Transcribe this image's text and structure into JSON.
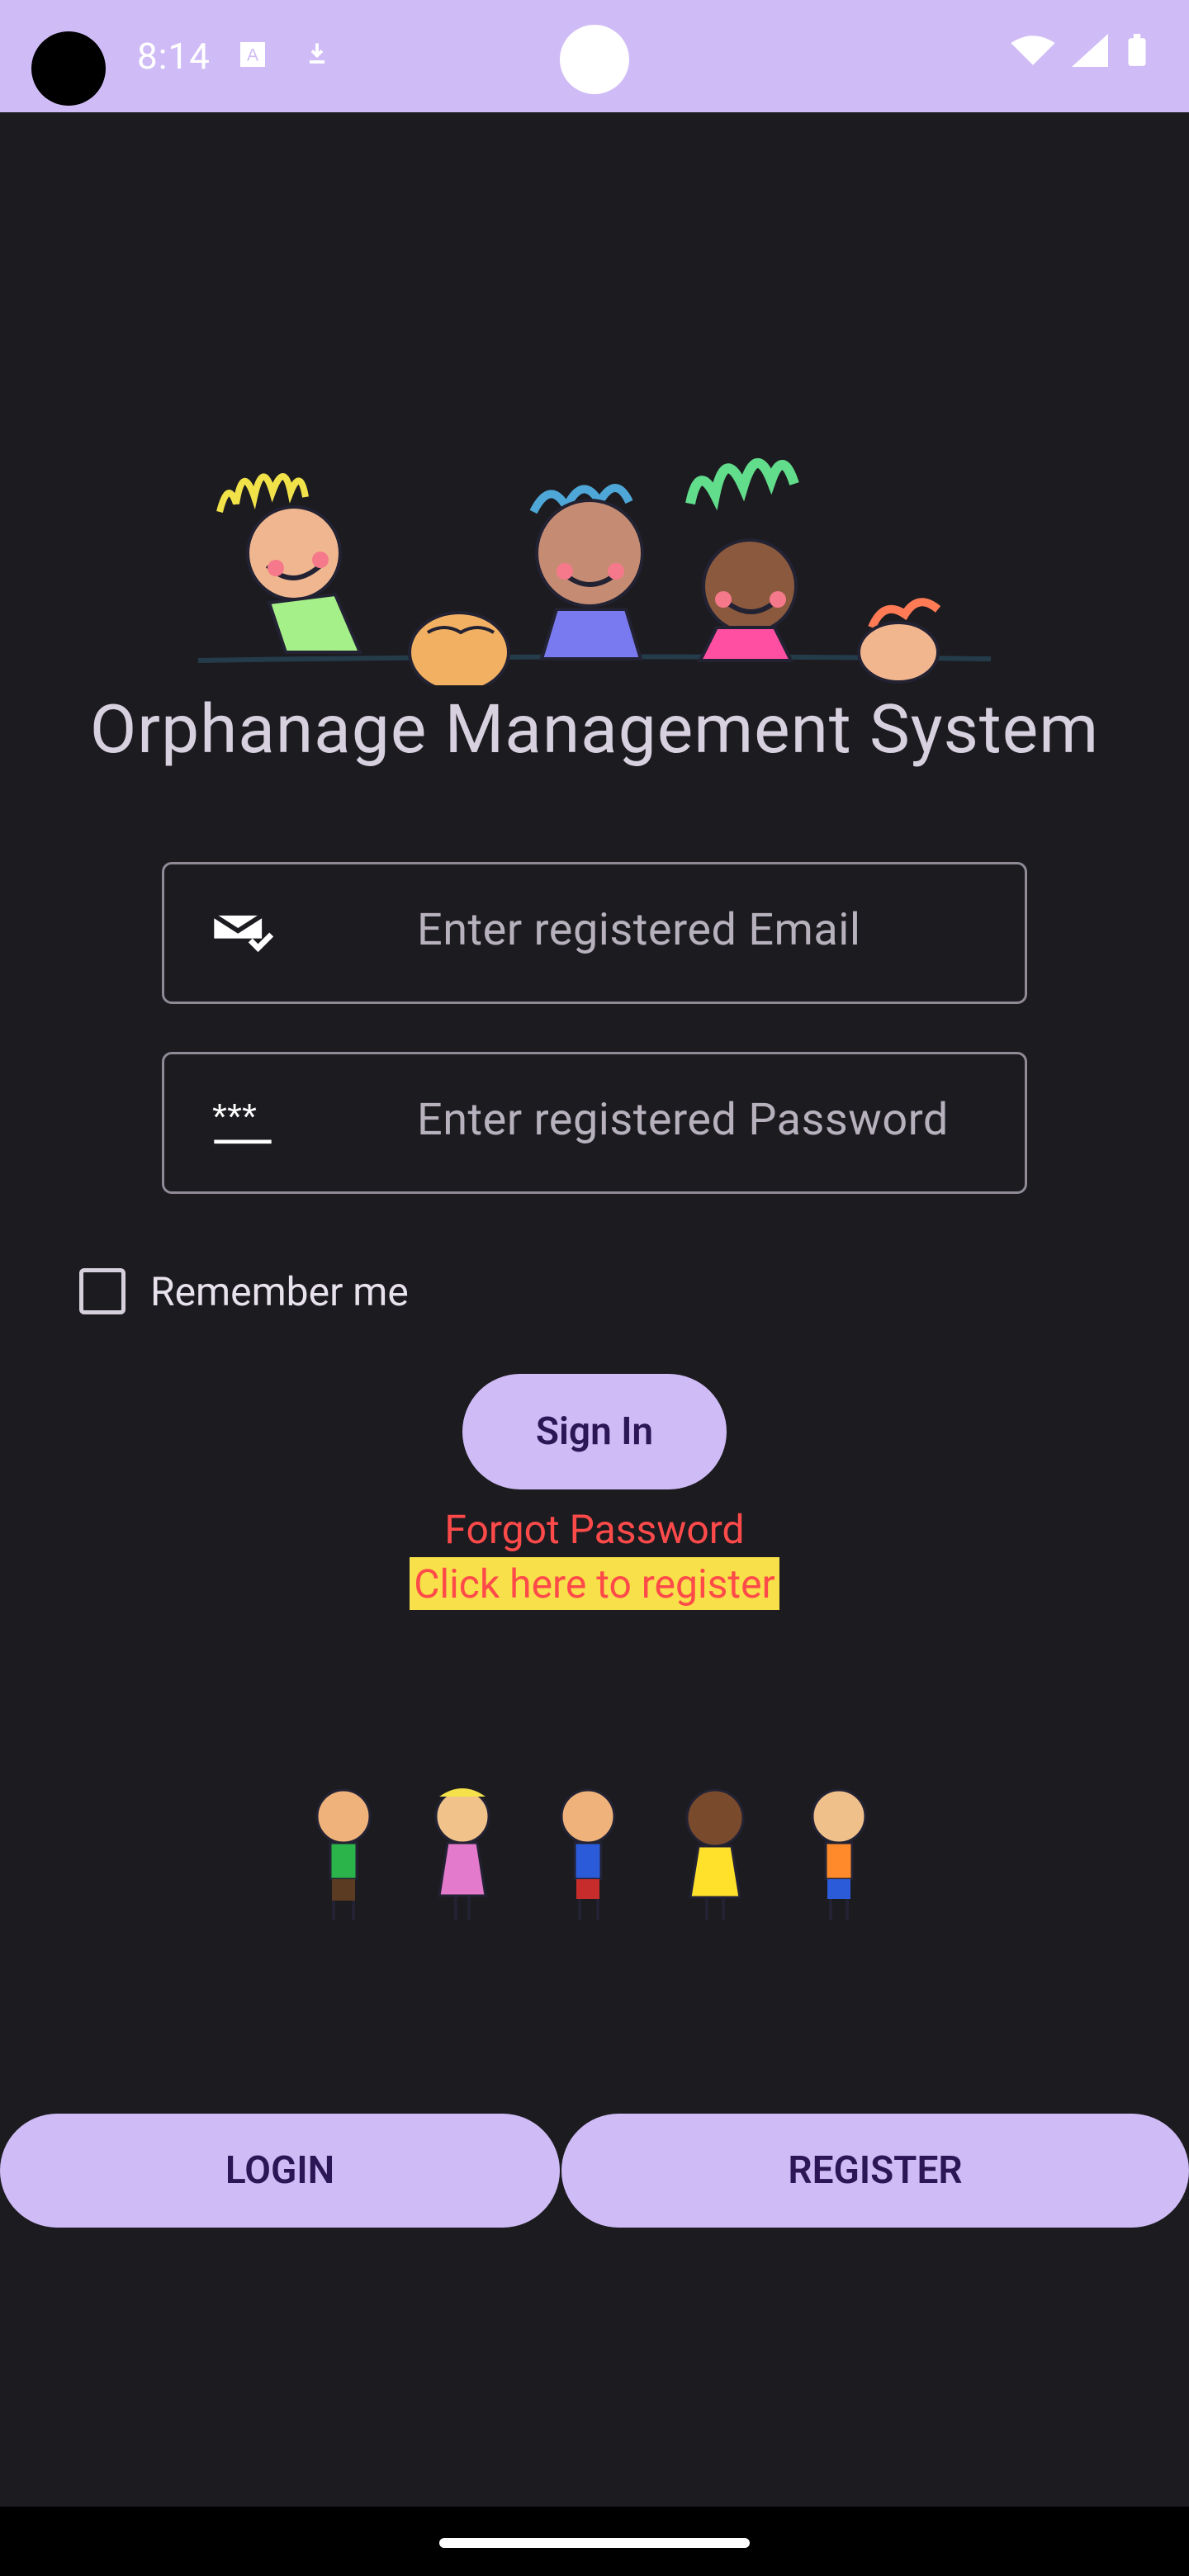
{
  "status_bar": {
    "time": "8:14"
  },
  "app": {
    "title": "Orphanage Management System",
    "email_placeholder": "Enter registered Email",
    "password_placeholder": "Enter registered Password",
    "remember_label": "Remember me",
    "signin_label": "Sign In",
    "forgot_label": "Forgot Password",
    "register_link_label": "Click here to register"
  },
  "bottom_nav": {
    "login_label": "LOGIN",
    "register_label": "REGISTER"
  }
}
